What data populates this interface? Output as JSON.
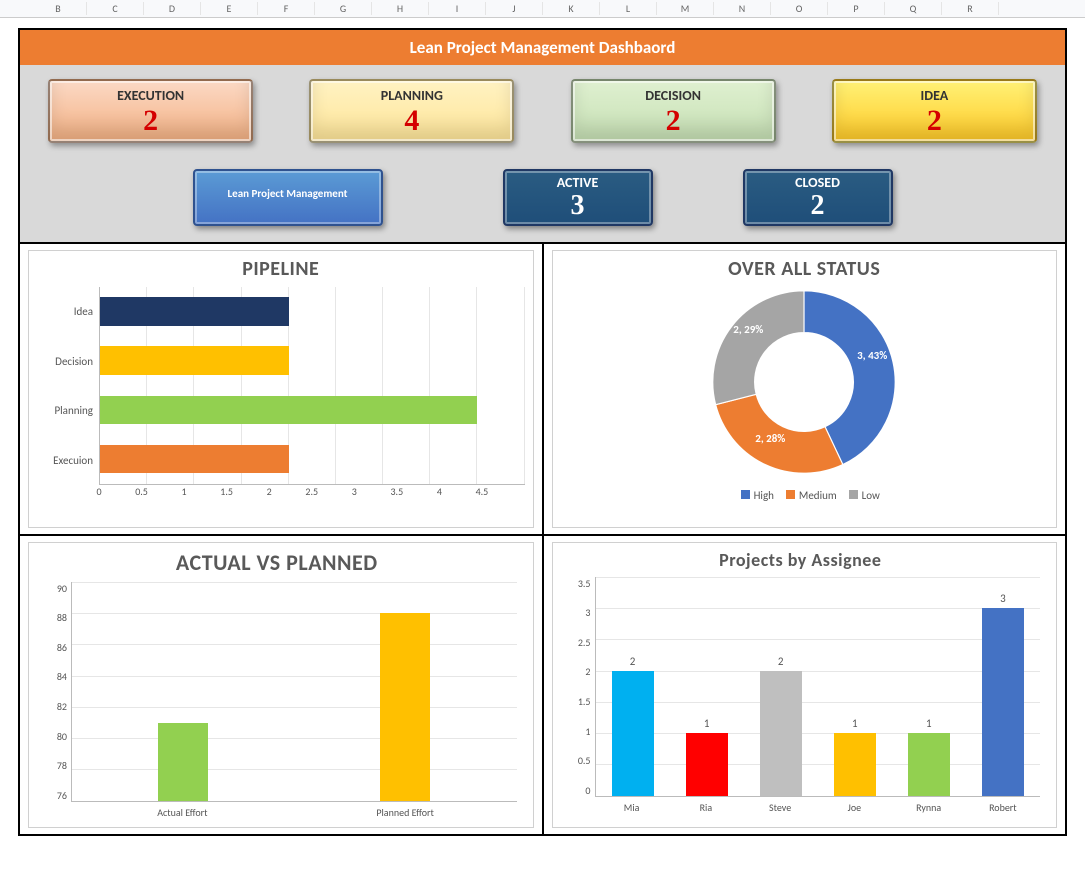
{
  "column_headers": [
    "B",
    "C",
    "D",
    "E",
    "F",
    "G",
    "H",
    "I",
    "J",
    "K",
    "L",
    "M",
    "N",
    "O",
    "P",
    "Q",
    "R"
  ],
  "title": "Lean Project Management Dashbaord",
  "tiles": [
    {
      "label": "EXECUTION",
      "value": 2,
      "cls": "t-exec"
    },
    {
      "label": "PLANNING",
      "value": 4,
      "cls": "t-plan"
    },
    {
      "label": "DECISION",
      "value": 2,
      "cls": "t-dec"
    },
    {
      "label": "IDEA",
      "value": 2,
      "cls": "t-idea"
    }
  ],
  "lpm_button": "Lean Project Management",
  "status_tiles": [
    {
      "label": "ACTIVE",
      "value": 3
    },
    {
      "label": "CLOSED",
      "value": 2
    }
  ],
  "pipeline": {
    "title": "PIPELINE",
    "rows": [
      {
        "label": "Idea",
        "value": 2,
        "color": "#1f3864"
      },
      {
        "label": "Decision",
        "value": 2,
        "color": "#ffc000"
      },
      {
        "label": "Planning",
        "value": 4,
        "color": "#92d050"
      },
      {
        "label": "Execuion",
        "value": 2,
        "color": "#ed7d31"
      }
    ],
    "xticks": [
      "0",
      "0.5",
      "1",
      "1.5",
      "2",
      "2.5",
      "3",
      "3.5",
      "4",
      "4.5"
    ],
    "xmax": 4.5
  },
  "overall": {
    "title": "OVER ALL  STATUS",
    "series": [
      {
        "name": "High",
        "value": 3,
        "pct": 43,
        "color": "#4472c4"
      },
      {
        "name": "Medium",
        "value": 2,
        "pct": 28,
        "color": "#ed7d31"
      },
      {
        "name": "Low",
        "value": 2,
        "pct": 29,
        "color": "#a5a5a5"
      }
    ],
    "labels": {
      "high": "3, 43%",
      "medium": "2, 28%",
      "low": "2, 29%"
    }
  },
  "avp": {
    "title": "ACTUAL VS PLANNED",
    "yticks": [
      "90",
      "88",
      "86",
      "84",
      "82",
      "80",
      "78",
      "76"
    ],
    "ymin": 76,
    "ymax": 90,
    "bars": [
      {
        "label": "Actual Effort",
        "value": 81,
        "color": "#92d050"
      },
      {
        "label": "Planned Effort",
        "value": 88,
        "color": "#ffc000"
      }
    ]
  },
  "assignee": {
    "title": "Projects by Assignee",
    "yticks": [
      "3.5",
      "3",
      "2.5",
      "2",
      "1.5",
      "1",
      "0.5",
      "0"
    ],
    "ymax": 3.5,
    "bars": [
      {
        "label": "Mia",
        "value": 2,
        "color": "#00b0f0"
      },
      {
        "label": "Ria",
        "value": 1,
        "color": "#ff0000"
      },
      {
        "label": "Steve",
        "value": 2,
        "color": "#bfbfbf"
      },
      {
        "label": "Joe",
        "value": 1,
        "color": "#ffc000"
      },
      {
        "label": "Rynna",
        "value": 1,
        "color": "#92d050"
      },
      {
        "label": "Robert",
        "value": 3,
        "color": "#4472c4"
      }
    ]
  },
  "chart_data": [
    {
      "type": "bar",
      "orientation": "horizontal",
      "title": "PIPELINE",
      "categories": [
        "Idea",
        "Decision",
        "Planning",
        "Execuion"
      ],
      "values": [
        2,
        2,
        4,
        2
      ],
      "xlim": [
        0,
        4.5
      ]
    },
    {
      "type": "pie",
      "variant": "doughnut",
      "title": "OVER ALL  STATUS",
      "categories": [
        "High",
        "Medium",
        "Low"
      ],
      "values": [
        3,
        2,
        2
      ],
      "percentages": [
        43,
        28,
        29
      ]
    },
    {
      "type": "bar",
      "title": "ACTUAL VS PLANNED",
      "categories": [
        "Actual Effort",
        "Planned Effort"
      ],
      "values": [
        81,
        88
      ],
      "ylim": [
        76,
        90
      ]
    },
    {
      "type": "bar",
      "title": "Projects by Assignee",
      "categories": [
        "Mia",
        "Ria",
        "Steve",
        "Joe",
        "Rynna",
        "Robert"
      ],
      "values": [
        2,
        1,
        2,
        1,
        1,
        3
      ],
      "ylim": [
        0,
        3.5
      ]
    }
  ]
}
